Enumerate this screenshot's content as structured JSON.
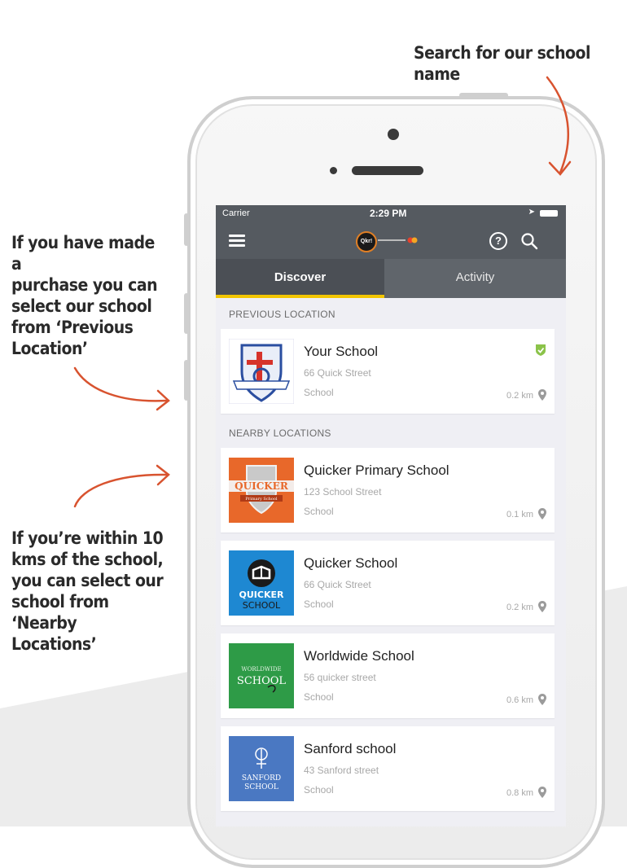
{
  "callouts": {
    "search": "Search for our school name",
    "previous": "If you have made a\npurchase you can\nselect our school\nfrom ‘Previous\nLocation’",
    "nearby": "If you’re within 10\nkms of the school,\nyou can select our\nschool from\n‘Nearby Locations’"
  },
  "status_bar": {
    "carrier": "Carrier",
    "time": "2:29 PM"
  },
  "app_bar": {
    "logo_text": "Qkr!",
    "icons": [
      "menu-icon",
      "help-icon",
      "search-icon"
    ]
  },
  "tabs": [
    {
      "label": "Discover",
      "active": true
    },
    {
      "label": "Activity",
      "active": false
    }
  ],
  "sections": {
    "previous": {
      "label": "PREVIOUS LOCATION",
      "items": [
        {
          "name": "Your School",
          "address": "66 Quick Street",
          "type": "School",
          "distance": "0.2 km",
          "verified": true
        }
      ]
    },
    "nearby": {
      "label": "NEARBY LOCATIONS",
      "items": [
        {
          "name": "Quicker Primary School",
          "address": "123 School Street",
          "type": "School",
          "distance": "0.1 km",
          "logo_text": [
            "QUICKER",
            "Primary School"
          ]
        },
        {
          "name": "Quicker School",
          "address": "66 Quick Street",
          "type": "School",
          "distance": "0.2 km",
          "logo_text": [
            "QUICKER",
            "SCHOOL"
          ]
        },
        {
          "name": "Worldwide School",
          "address": "56 quicker street",
          "type": "School",
          "distance": "0.6 km",
          "logo_text": [
            "WORLDWIDE",
            "SCHOOL"
          ]
        },
        {
          "name": "Sanford school",
          "address": "43 Sanford street",
          "type": "School",
          "distance": "0.8 km",
          "logo_text": [
            "SANFORD",
            "SCHOOL"
          ]
        }
      ]
    }
  },
  "colors": {
    "app_bar": "#555a60",
    "tab_indicator": "#f2c500",
    "arrow": "#d8532f",
    "verified": "#8bc34a",
    "screen_bg": "#efeff4"
  }
}
